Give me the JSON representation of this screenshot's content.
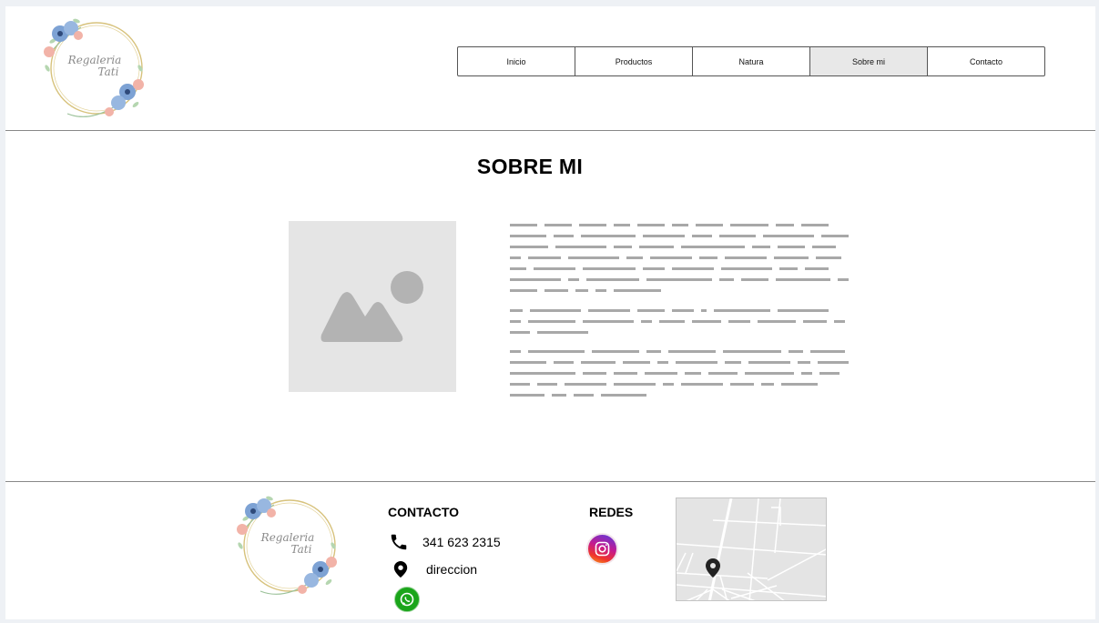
{
  "brand": {
    "name_line1": "Regaleria",
    "name_line2": "Tati"
  },
  "nav": {
    "items": [
      {
        "label": "Inicio"
      },
      {
        "label": "Productos"
      },
      {
        "label": "Natura"
      },
      {
        "label": "Sobre mi",
        "active": true
      },
      {
        "label": "Contacto"
      }
    ]
  },
  "main": {
    "title": "SOBRE MI",
    "image_icon": "image-placeholder-icon"
  },
  "footer": {
    "contact_heading": "CONTACTO",
    "phone": "341 623 2315",
    "address": "direccion",
    "social_heading": "REDES",
    "icons": {
      "phone": "phone-icon",
      "location": "location-pin-icon",
      "whatsapp": "whatsapp-icon",
      "instagram": "instagram-icon",
      "map": "map-icon"
    }
  },
  "colors": {
    "active_nav_bg": "#e8e8e8",
    "placeholder_gray": "#b3b3b3",
    "whatsapp_green": "#1aa51a"
  }
}
